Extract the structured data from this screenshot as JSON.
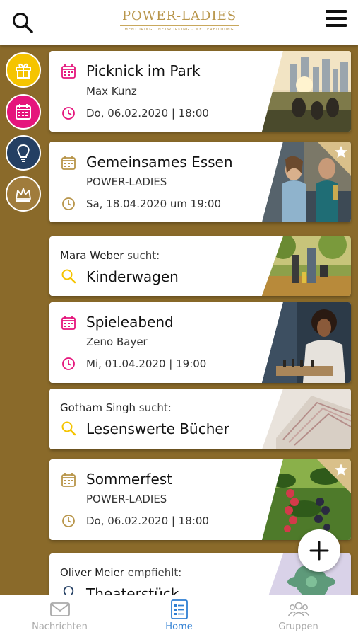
{
  "header": {
    "logo_text": "POWER-LADIES",
    "logo_tagline": "MENTORING · NETWORKING · WEITERBILDUNG",
    "search_icon": "search-icon",
    "menu_icon": "hamburger-menu-icon"
  },
  "sidebar": [
    {
      "name": "gift",
      "icon": "gift-icon",
      "color": "#f5c400"
    },
    {
      "name": "calendar",
      "icon": "calendar-icon",
      "color": "#e5157c"
    },
    {
      "name": "idea",
      "icon": "lightbulb-icon",
      "color": "#243f63"
    },
    {
      "name": "crown",
      "icon": "crown-icon",
      "color": "#a07c3c"
    }
  ],
  "feed": {
    "event1": {
      "title": "Picknick im Park",
      "organizer": "Max Kunz",
      "datetime": "Do, 06.02.2020 | 18:00",
      "accent": "#e5157c",
      "starred": false
    },
    "event2": {
      "title": "Gemeinsames Essen",
      "organizer": "POWER-LADIES",
      "datetime": "Sa, 18.04.2020 um 19:00",
      "accent": "#b8954a",
      "starred": true
    },
    "search1": {
      "person": "Mara Weber",
      "verb": "sucht:",
      "item": "Kinderwagen"
    },
    "event3": {
      "title": "Spieleabend",
      "organizer": "Zeno Bayer",
      "datetime": "Mi, 01.04.2020 | 19:00",
      "accent": "#e5157c",
      "starred": false
    },
    "search2": {
      "person": "Gotham Singh",
      "verb": "sucht:",
      "item": "Lesenswerte Bücher"
    },
    "event4": {
      "title": "Sommerfest",
      "organizer": "POWER-LADIES",
      "datetime": "Do, 06.02.2020 | 18:00",
      "accent": "#b8954a",
      "starred": true
    },
    "recommend1": {
      "person": "Oliver Meier",
      "verb": "empfiehlt:",
      "item": "Theaterstück"
    }
  },
  "fab": {
    "icon": "plus-icon"
  },
  "bottom_nav": [
    {
      "label": "Nachrichten",
      "icon": "envelope-icon",
      "active": false
    },
    {
      "label": "Home",
      "icon": "list-icon",
      "active": true
    },
    {
      "label": "Gruppen",
      "icon": "group-icon",
      "active": false
    }
  ],
  "colors": {
    "background": "#8a6a2a",
    "accent_pink": "#e5157c",
    "accent_gold": "#b8954a",
    "search_yellow": "#f5c400",
    "nav_active": "#2f7fd3"
  }
}
